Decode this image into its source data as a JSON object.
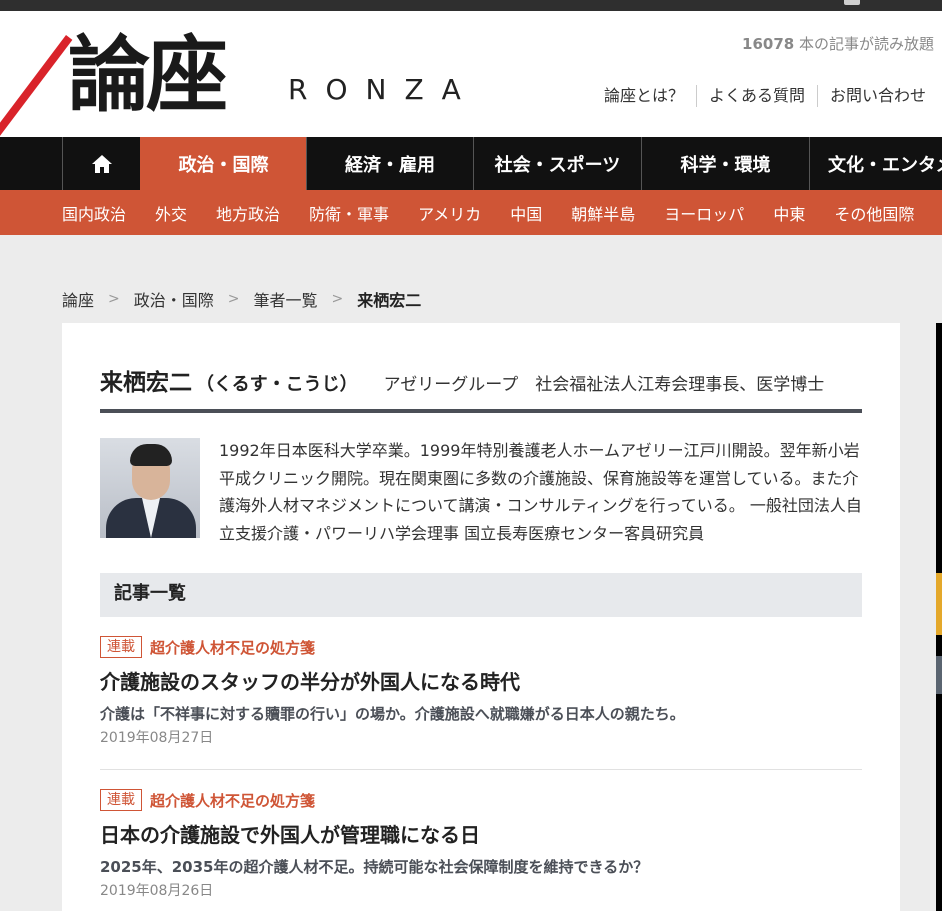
{
  "site": {
    "logo_kanji": "論座",
    "logo_latin": "RONZA",
    "read_count": "16078",
    "read_suffix": " 本の記事が読み放題",
    "util_links": [
      "論座とは？",
      "よくある質問",
      "お問い合わせ"
    ]
  },
  "nav": {
    "home_icon": "home-icon",
    "items": [
      "政治・国際",
      "経済・雇用",
      "社会・スポーツ",
      "科学・環境",
      "文化・エンタメ"
    ],
    "active_index": 0,
    "sub_items": [
      "国内政治",
      "外交",
      "地方政治",
      "防衛・軍事",
      "アメリカ",
      "中国",
      "朝鮮半島",
      "ヨーロッパ",
      "中東",
      "その他国際"
    ]
  },
  "breadcrumb": [
    "論座",
    "政治・国際",
    "筆者一覧",
    "来栖宏二"
  ],
  "breadcrumb_sep": ">",
  "author": {
    "name": "来栖宏二",
    "kana": "（くるす・こうじ）",
    "title": "アゼリーグループ　社会福祉法人江寿会理事長、医学博士",
    "bio": "1992年日本医科大学卒業。1999年特別養護老人ホームアゼリー江戸川開設。翌年新小岩平成クリニック開院。現在関東圏に多数の介護施設、保育施設等を運営している。また介護海外人材マネジメントについて講演・コンサルティングを行っている。 一般社団法人自立支援介護・パワーリハ学会理事 国立長寿医療センター客員研究員"
  },
  "section_title": "記事一覧",
  "articles": [
    {
      "badge": "連載",
      "series": "超介護人材不足の処方箋",
      "title": "介護施設のスタッフの半分が外国人になる時代",
      "subtitle": "介護は「不祥事に対する贖罪の行い」の場か。介護施設へ就職嫌がる日本人の親たち。",
      "date": "2019年08月27日"
    },
    {
      "badge": "連載",
      "series": "超介護人材不足の処方箋",
      "title": "日本の介護施設で外国人が管理職になる日",
      "subtitle": "2025年、2035年の超介護人材不足。持続可能な社会保障制度を維持できるか？",
      "date": "2019年08月26日"
    }
  ],
  "colors": {
    "accent": "#cf5536",
    "nav_bg": "#111111",
    "divider": "#4b4f57"
  }
}
